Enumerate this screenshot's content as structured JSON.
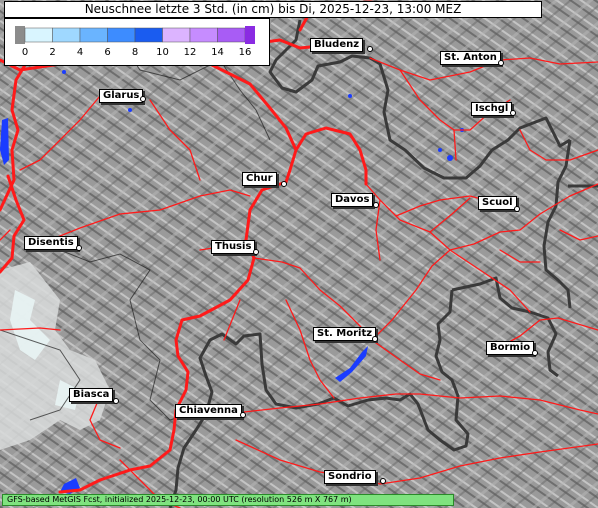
{
  "title": "Neuschnee letzte 3 Std. (in cm) bis Di, 2025-12-23, 13:00 MEZ",
  "legend": {
    "ticks": [
      "0",
      "2",
      "4",
      "6",
      "8",
      "10",
      "12",
      "14",
      "16"
    ],
    "colors": [
      "#d9f5ff",
      "#9fd8ff",
      "#6ab4ff",
      "#3d8cff",
      "#1a5cf0",
      "#dcb4ff",
      "#c68cff",
      "#a85cf5",
      "#8a2be2"
    ]
  },
  "cities": [
    {
      "id": "bludenz",
      "name": "Bludenz"
    },
    {
      "id": "st-anton",
      "name": "St. Anton"
    },
    {
      "id": "glarus",
      "name": "Glarus"
    },
    {
      "id": "ischgl",
      "name": "Ischgl"
    },
    {
      "id": "chur",
      "name": "Chur"
    },
    {
      "id": "davos",
      "name": "Davos"
    },
    {
      "id": "scuol",
      "name": "Scuol"
    },
    {
      "id": "disentis",
      "name": "Disentis"
    },
    {
      "id": "thusis",
      "name": "Thusis"
    },
    {
      "id": "st-moritz",
      "name": "St. Moritz"
    },
    {
      "id": "bormio",
      "name": "Bormio"
    },
    {
      "id": "biasca",
      "name": "Biasca"
    },
    {
      "id": "chiavenna",
      "name": "Chiavenna"
    },
    {
      "id": "sondrio",
      "name": "Sondrio"
    }
  ],
  "footer": "GFS-based MetGIS Fcst, initialized 2025-12-23, 00:00 UTC  (resolution 526 m X 767 m)",
  "colors": {
    "road": "#ff1a1a",
    "border": "#3a3a3a",
    "water": "#1a3cff",
    "terrain": "#9a9a9a",
    "footer_bg": "#7fe37f"
  }
}
